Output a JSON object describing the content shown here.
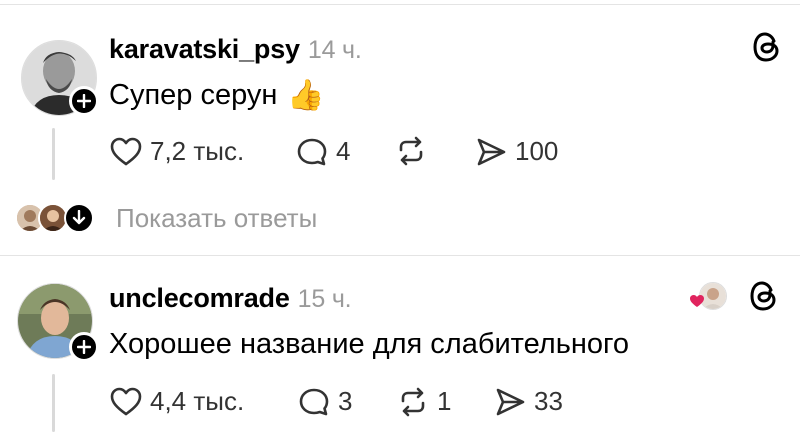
{
  "comments": [
    {
      "username": "karavatski_psy",
      "time": "14 ч.",
      "text": "Супер серун",
      "emoji": "👍",
      "likes": "7,2 тыс.",
      "replies": "4",
      "reposts": "",
      "shares": "100"
    },
    {
      "username": "unclecomrade",
      "time": "15 ч.",
      "text": "Хорошее название для слабительного",
      "likes": "4,4 тыс.",
      "replies": "3",
      "reposts": "1",
      "shares": "33"
    }
  ],
  "show_replies_label": "Показать ответы",
  "icons": {
    "like": "heart-outline-icon",
    "reply": "speech-bubble-icon",
    "repost": "repost-arrows-icon",
    "share": "paper-plane-icon",
    "threads": "threads-logo-icon",
    "follow": "plus-icon"
  },
  "colors": {
    "text": "#000000",
    "muted": "#9a9a9a",
    "liked_heart": "#e0245e"
  }
}
